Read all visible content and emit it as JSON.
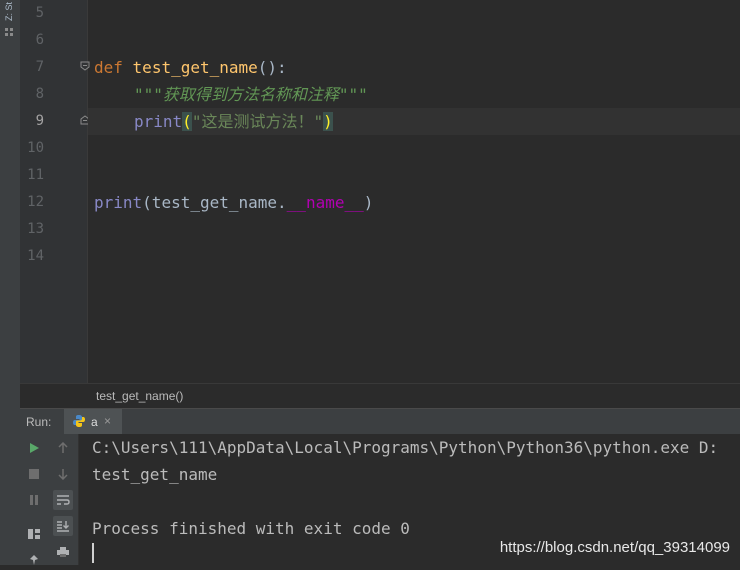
{
  "left_strip": {
    "label": "Z: St"
  },
  "editor": {
    "line_numbers": [
      "5",
      "6",
      "7",
      "8",
      "9",
      "10",
      "11",
      "12",
      "13",
      "14"
    ],
    "active_line": "9",
    "lines": {
      "l7": {
        "kw_def": "def",
        "fn_name": "test_get_name",
        "params": "():"
      },
      "l8": {
        "docstring": "\"\"\"获取得到方法名称和注释\"\"\""
      },
      "l9": {
        "builtin_print": "print",
        "open_paren": "(",
        "string": "\"这是测试方法！\"",
        "close_paren": ")"
      },
      "l12": {
        "builtin_print": "print",
        "open": "(test_get_name.",
        "dunder": "__name__",
        "close": ")"
      }
    }
  },
  "breadcrumb": {
    "text": "test_get_name()"
  },
  "run_panel": {
    "label": "Run:",
    "tab_name": "a",
    "tab_close": "×"
  },
  "console": {
    "lines": [
      "C:\\Users\\111\\AppData\\Local\\Programs\\Python\\Python36\\python.exe D:",
      "test_get_name",
      "",
      "Process finished with exit code 0"
    ]
  },
  "watermark": "https://blog.csdn.net/qq_39314099",
  "colors": {
    "keyword": "#cc7832",
    "function": "#ffc66d",
    "docstring": "#629755",
    "string": "#6a8759",
    "builtin": "#8888c6",
    "dunder": "#b200b2"
  }
}
